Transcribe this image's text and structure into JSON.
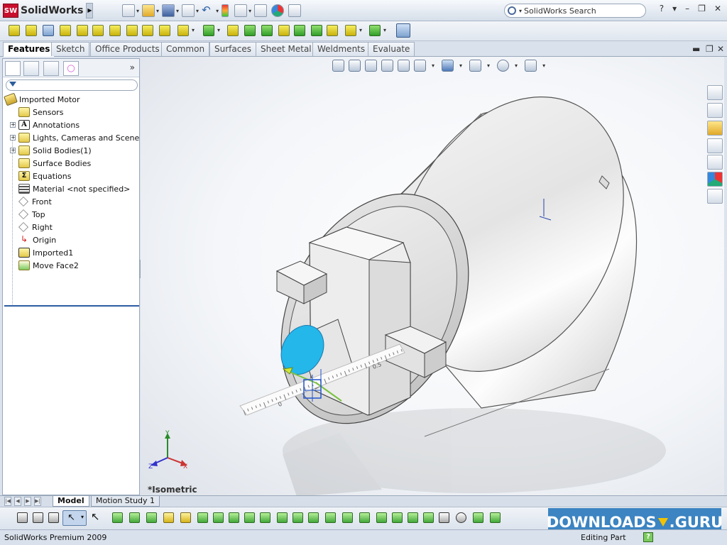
{
  "app": {
    "logo_badge": "SW",
    "name": "SolidWorks"
  },
  "search": {
    "placeholder": "SolidWorks Search"
  },
  "window_controls": {
    "help": "?",
    "minimize": "–",
    "restore": "❐",
    "close": "✕"
  },
  "tabs": [
    {
      "label": "Features",
      "active": true
    },
    {
      "label": "Sketch"
    },
    {
      "label": "Office Products"
    },
    {
      "label": "Common"
    },
    {
      "label": "Surfaces"
    },
    {
      "label": "Sheet Metal"
    },
    {
      "label": "Weldments"
    },
    {
      "label": "Evaluate"
    }
  ],
  "panel": {
    "collapse_label": "»"
  },
  "tree": {
    "root": "Imported Motor",
    "items": [
      {
        "label": "Sensors",
        "icon": "sensor-icon"
      },
      {
        "label": "Annotations",
        "icon": "annotation-icon",
        "expandable": true
      },
      {
        "label": "Lights, Cameras and Scene",
        "icon": "lights-icon",
        "expandable": true
      },
      {
        "label": "Solid Bodies(1)",
        "icon": "solid-bodies-icon",
        "expandable": true
      },
      {
        "label": "Surface Bodies",
        "icon": "surface-bodies-icon"
      },
      {
        "label": "Equations",
        "icon": "equations-icon"
      },
      {
        "label": "Material <not specified>",
        "icon": "material-icon"
      },
      {
        "label": "Front",
        "icon": "plane-icon"
      },
      {
        "label": "Top",
        "icon": "plane-icon"
      },
      {
        "label": "Right",
        "icon": "plane-icon"
      },
      {
        "label": "Origin",
        "icon": "origin-icon"
      },
      {
        "label": "Imported1",
        "icon": "imported-feature-icon"
      },
      {
        "label": "Move Face2",
        "icon": "move-face-icon"
      }
    ]
  },
  "viewport": {
    "view_label": "*Isometric",
    "ruler_ticks": [
      "0",
      "0.5"
    ],
    "axes": {
      "x": "X",
      "y": "Y",
      "z": "Z"
    }
  },
  "bottom_tabs": [
    {
      "label": "Model",
      "active": true
    },
    {
      "label": "Motion Study 1"
    }
  ],
  "watermark": {
    "left": "DOWNLOADS",
    "right": ".GURU"
  },
  "status": {
    "product": "SolidWorks Premium 2009",
    "mode": "Editing Part",
    "help": "?"
  },
  "colors": {
    "accent": "#3c84c2",
    "brand_red": "#c8102e",
    "selected_face": "#23b7ea",
    "rollback_bar": "#2d5da2"
  }
}
